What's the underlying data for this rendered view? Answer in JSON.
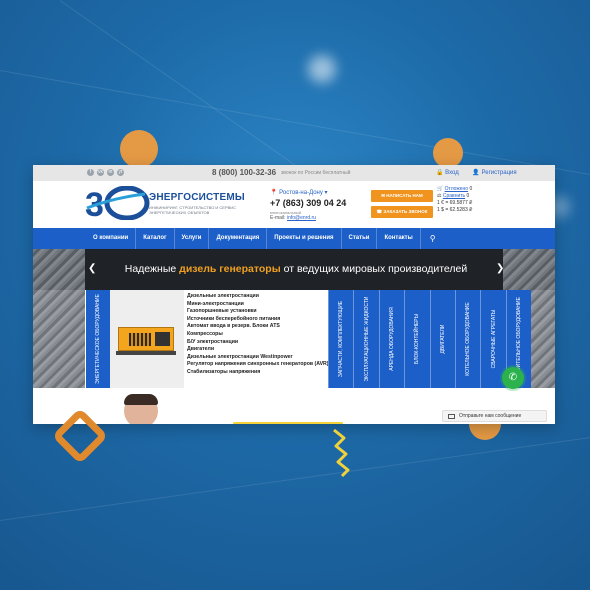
{
  "topbar": {
    "social": [
      "f",
      "vk",
      "in",
      "yt"
    ],
    "phone": "8 (800) 100-32-36",
    "phone_note": "звонок по России бесплатный",
    "login": "Вход",
    "register": "Регистрация"
  },
  "header": {
    "logo_name": "ЭНЕРГОСИСТЕМЫ",
    "logo_tagline": "ИНЖИНИРИНГ, СТРОИТЕЛЬСТВО И СЕРВИС ЭНЕРГЕТИЧЕСКИХ ОБЪЕКТОВ",
    "city": "Ростов-на-Дону",
    "city_phone": "+7 (863) 309 04 24",
    "city_note": "многоканальный",
    "email_label": "E-mail:",
    "email": "info@enrd.ru",
    "write_button": "НАПИСАТЬ НАМ",
    "callback_button": "ЗАКАЗАТЬ ЗВОНОК",
    "compare_label": "Отложено",
    "compare_count": "0",
    "cart_label": "Сравнить",
    "cart_count": "0",
    "rate_eur": "1 € = 69.5877 ₽",
    "rate_usd": "1 $ = 62.5283 ₽"
  },
  "nav": {
    "items": [
      "О компании",
      "Каталог",
      "Услуги",
      "Документация",
      "Проекты и решения",
      "Статьи",
      "Контакты"
    ],
    "search_icon": "search-icon"
  },
  "hero": {
    "text_before": "Надежные",
    "text_highlight": "дизель генераторы",
    "text_after": "от ведущих мировых производителей"
  },
  "catalog": {
    "first_column": "ЭНЕРГЕТИЧЕСКОЕ ОБОРУДОВАНИЕ",
    "list": [
      "Дизельные электростанции",
      "Мини-электростанции",
      "Газопоршневые установки",
      "Источники бесперебойного питания",
      "Автомат ввода в резерв. Блоки АТS",
      "Компрессоры",
      "Б/У электростанции",
      "Двигатели",
      "Дизельные электростанции Westinpower",
      "Регулятор напряжения синхронных генераторов (AVR)",
      "Стабилизаторы напряжения"
    ],
    "columns": [
      "ЗАПЧАСТИ, КОМПЛЕКТУЮЩИЕ",
      "ЭКСПЛУАТАЦИОННЫЕ ЖИДКОСТИ",
      "АРЕНДА ОБОРУДОВАНИЯ",
      "БЛОК-КОНТЕЙНЕРЫ",
      "ДВИГАТЕЛИ",
      "КОТЕЛЬНОЕ ОБОРУДОВАНИЕ",
      "СВАРОЧНЫЕ АГРЕГАТЫ",
      "СТРОИТЕЛЬНОЕ ОБОРУДОВАНИЕ"
    ]
  },
  "chat": {
    "label": "Отправьте нам сообщение"
  },
  "colors": {
    "brand_blue": "#1d5fc9",
    "accent_orange": "#f0931f",
    "whatsapp_green": "#2bb24c"
  }
}
